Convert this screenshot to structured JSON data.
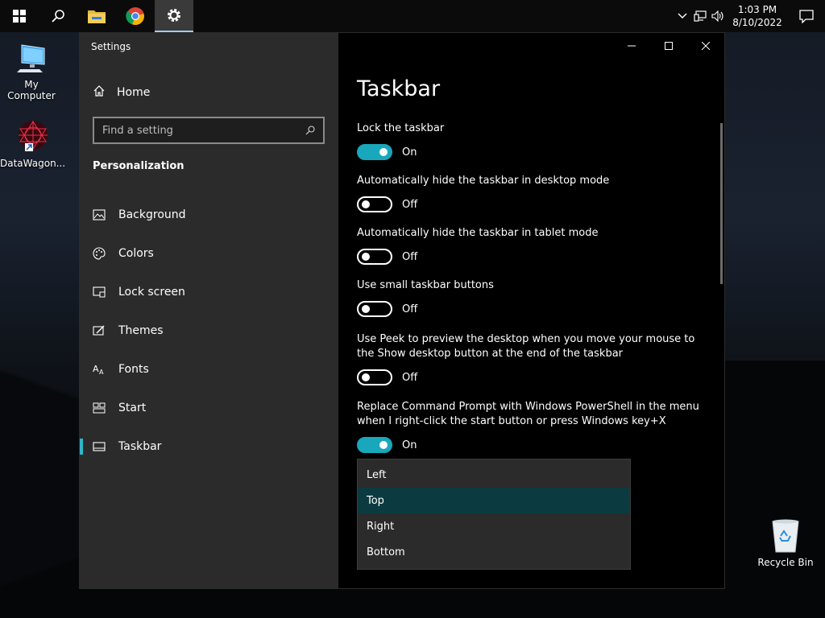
{
  "taskbar": {
    "clock_time": "1:03 PM",
    "clock_date": "8/10/2022"
  },
  "desktop": {
    "icons": [
      {
        "label": "My Computer"
      },
      {
        "label": "DataWagon..."
      },
      {
        "label": "Recycle Bin"
      }
    ]
  },
  "window": {
    "title": "Settings",
    "accent_color": "#19a7bb"
  },
  "sidebar": {
    "home_label": "Home",
    "search_placeholder": "Find a setting",
    "section_title": "Personalization",
    "items": [
      {
        "label": "Background",
        "icon": "image-icon"
      },
      {
        "label": "Colors",
        "icon": "palette-icon"
      },
      {
        "label": "Lock screen",
        "icon": "lock-screen-icon"
      },
      {
        "label": "Themes",
        "icon": "themes-icon"
      },
      {
        "label": "Fonts",
        "icon": "fonts-icon"
      },
      {
        "label": "Start",
        "icon": "start-icon"
      },
      {
        "label": "Taskbar",
        "icon": "taskbar-icon",
        "selected": true
      }
    ]
  },
  "content": {
    "title": "Taskbar",
    "settings": [
      {
        "label": "Lock the taskbar",
        "state": "On"
      },
      {
        "label": "Automatically hide the taskbar in desktop mode",
        "state": "Off"
      },
      {
        "label": "Automatically hide the taskbar in tablet mode",
        "state": "Off"
      },
      {
        "label": "Use small taskbar buttons",
        "state": "Off"
      },
      {
        "label": "Use Peek to preview the desktop when you move your mouse to the Show desktop button at the end of the taskbar",
        "state": "Off"
      },
      {
        "label": "Replace Command Prompt with Windows PowerShell in the menu when I right-click the start button or press Windows key+X",
        "state": "On"
      }
    ]
  },
  "dropdown": {
    "options": [
      "Left",
      "Top",
      "Right",
      "Bottom"
    ],
    "selected": "Top"
  }
}
